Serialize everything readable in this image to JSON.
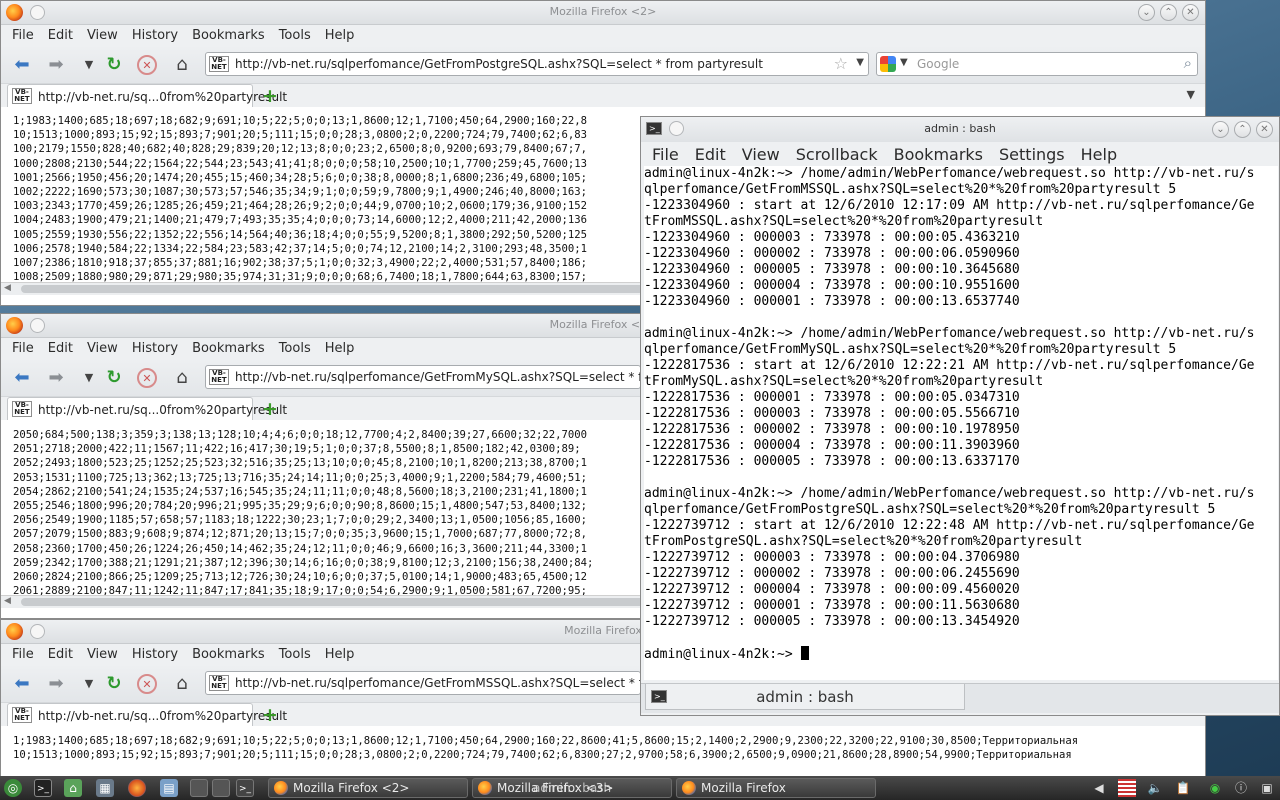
{
  "firefox_menu": [
    "File",
    "Edit",
    "View",
    "History",
    "Bookmarks",
    "Tools",
    "Help"
  ],
  "favicon_text": "VB-\nNET",
  "search_placeholder": "Google",
  "windows": [
    {
      "title": "Mozilla Firefox <2>",
      "url": "http://vb-net.ru/sqlperfomance/GetFromPostgreSQL.ashx?SQL=select * from partyresult",
      "tab_label": "http://vb-net.ru/sq...0from%20partyresult",
      "lines": [
        "1;1983;1400;685;18;697;18;682;9;691;10;5;22;5;0;0;13;1,8600;12;1,7100;450;64,2900;160;22,8",
        "10;1513;1000;893;15;92;15;893;7;901;20;5;111;15;0;0;28;3,0800;2;0,2200;724;79,7400;62;6,83",
        "100;2179;1550;828;40;682;40;828;29;839;20;12;13;8;0;0;23;2,6500;8;0,9200;693;79,8400;67;7,",
        "1000;2808;2130;544;22;1564;22;544;23;543;41;41;8;0;0;0;58;10,2500;10;1,7700;259;45,7600;13",
        "1001;2566;1950;456;20;1474;20;455;15;460;34;28;5;6;0;0;38;8,0000;8;1,6800;236;49,6800;105;",
        "1002;2222;1690;573;30;1087;30;573;57;546;35;34;9;1;0;0;59;9,7800;9;1,4900;246;40,8000;163;",
        "1003;2343;1770;459;26;1285;26;459;21;464;28;26;9;2;0;0;44;9,0700;10;2,0600;179;36,9100;152",
        "1004;2483;1900;479;21;1400;21;479;7;493;35;35;4;0;0;0;73;14,6000;12;2,4000;211;42,2000;136",
        "1005;2559;1930;556;22;1352;22;556;14;564;40;36;18;4;0;0;55;9,5200;8;1,3800;292;50,5200;125",
        "1006;2578;1940;584;22;1334;22;584;23;583;42;37;14;5;0;0;74;12,2100;14;2,3100;293;48,3500;1",
        "1007;2386;1810;918;37;855;37;881;16;902;38;37;5;1;0;0;32;3,4900;22;2,4000;531;57,8400;186;",
        "1008;2509;1880;980;29;871;29;980;35;974;31;31;9;0;0;0;68;6,7400;18;1,7800;644;63,8300;157;"
      ]
    },
    {
      "title": "Mozilla Firefox <3>",
      "url": "http://vb-net.ru/sqlperfomance/GetFromMySQL.ashx?SQL=select * from pa",
      "tab_label": "http://vb-net.ru/sq...0from%20partyresult",
      "lines": [
        "2050;684;500;138;3;359;3;138;13;128;10;4;4;6;0;0;18;12,7700;4;2,8400;39;27,6600;32;22,7000",
        "2051;2718;2000;422;11;1567;11;422;16;417;30;19;5;1;0;0;37;8,5500;8;1,8500;182;42,0300;89;",
        "2052;2493;1800;523;25;1252;25;523;32;516;35;25;13;10;0;0;45;8,2100;10;1,8200;213;38,8700;1",
        "2053;1531;1100;725;13;362;13;725;13;716;35;24;14;11;0;0;25;3,4000;9;1,2200;584;79,4600;51;",
        "2054;2862;2100;541;24;1535;24;537;16;545;35;24;11;11;0;0;48;8,5600;18;3,2100;231;41,1800;1",
        "2055;2546;1800;996;20;784;20;996;21;995;35;29;9;6;0;0;90;8,8600;15;1,4800;547;53,8400;132;",
        "2056;2549;1900;1185;57;658;57;1183;18;1222;30;23;1;7;0;0;29;2,3400;13;1,0500;1056;85,1600;",
        "2057;2079;1500;883;9;608;9;874;12;871;20;13;15;7;0;0;35;3,9600;15;1,7000;687;77,8000;72;8,",
        "2058;2360;1700;450;26;1224;26;450;14;462;35;24;12;11;0;0;46;9,6600;16;3,3600;211;44,3300;1",
        "2059;2342;1700;388;21;1291;21;387;12;396;30;14;6;16;0;0;38;9,8100;12;3,2100;156;38,2400;84;",
        "2060;2824;2100;866;25;1209;25;713;12;726;30;24;10;6;0;0;37;5,0100;14;1,9000;483;65,4500;12",
        "2061;2889;2100;847;11;1242;11;847;17;841;35;18;9;17;0;0;54;6,2900;9;1,0500;581;67,7200;95;"
      ]
    },
    {
      "title": "Mozilla Firefox",
      "url": "http://vb-net.ru/sqlperfomance/GetFromMSSQL.ashx?SQL=select * from pa",
      "tab_label": "http://vb-net.ru/sq...0from%20partyresult",
      "lines": [
        "1;1983;1400;685;18;697;18;682;9;691;10;5;22;5;0;0;13;1,8600;12;1,7100;450;64,2900;160;22,8600;41;5,8600;15;2,1400;2,2900;9,2300;22,3200;22,9100;30,8500;Территориальная",
        "10;1513;1000;893;15;92;15;893;7;901;20;5;111;15;0;0;28;3,0800;2;0,2200;724;79,7400;62;6,8300;27;2,9700;58;6,3900;2,6500;9,0900;21,8600;28,8900;54,9900;Территориальная"
      ]
    }
  ],
  "konsole": {
    "title": "admin : bash",
    "menu": [
      "File",
      "Edit",
      "View",
      "Scrollback",
      "Bookmarks",
      "Settings",
      "Help"
    ],
    "tab_label": "admin : bash",
    "lines": [
      "admin@linux-4n2k:~> /home/admin/WebPerfomance/webrequest.so http://vb-net.ru/s",
      "qlperfomance/GetFromMSSQL.ashx?SQL=select%20*%20from%20partyresult 5",
      "-1223304960 : start at 12/6/2010 12:17:09 AM http://vb-net.ru/sqlperfomance/Ge",
      "tFromMSSQL.ashx?SQL=select%20*%20from%20partyresult",
      "-1223304960 : 000003 : 733978 : 00:00:05.4363210",
      "-1223304960 : 000002 : 733978 : 00:00:06.0590960",
      "-1223304960 : 000005 : 733978 : 00:00:10.3645680",
      "-1223304960 : 000004 : 733978 : 00:00:10.9551600",
      "-1223304960 : 000001 : 733978 : 00:00:13.6537740",
      "",
      "admin@linux-4n2k:~> /home/admin/WebPerfomance/webrequest.so http://vb-net.ru/s",
      "qlperfomance/GetFromMySQL.ashx?SQL=select%20*%20from%20partyresult 5",
      "-1222817536 : start at 12/6/2010 12:22:21 AM http://vb-net.ru/sqlperfomance/Ge",
      "tFromMySQL.ashx?SQL=select%20*%20from%20partyresult",
      "-1222817536 : 000001 : 733978 : 00:00:05.0347310",
      "-1222817536 : 000003 : 733978 : 00:00:05.5566710",
      "-1222817536 : 000002 : 733978 : 00:00:10.1978950",
      "-1222817536 : 000004 : 733978 : 00:00:11.3903960",
      "-1222817536 : 000005 : 733978 : 00:00:13.6337170",
      "",
      "admin@linux-4n2k:~> /home/admin/WebPerfomance/webrequest.so http://vb-net.ru/s",
      "qlperfomance/GetFromPostgreSQL.ashx?SQL=select%20*%20from%20partyresult 5",
      "-1222739712 : start at 12/6/2010 12:22:48 AM http://vb-net.ru/sqlperfomance/Ge",
      "tFromPostgreSQL.ashx?SQL=select%20*%20from%20partyresult",
      "-1222739712 : 000003 : 733978 : 00:00:04.3706980",
      "-1222739712 : 000002 : 733978 : 00:00:06.2455690",
      "-1222739712 : 000004 : 733978 : 00:00:09.4560020",
      "-1222739712 : 000001 : 733978 : 00:00:11.5630680",
      "-1222739712 : 000005 : 733978 : 00:00:13.3454920",
      "",
      "admin@linux-4n2k:~> "
    ]
  },
  "taskbar": {
    "tasks": [
      "Mozilla Firefox <2>",
      "Mozilla Firefox <3>",
      "Mozilla Firefox"
    ],
    "overlap_label": "admin : bash"
  },
  "colors": {
    "chrome_bg": "#eef0f2",
    "taskbar_bg": "#2f2f2f",
    "reload": "#2e9a2e",
    "back": "#3b78c2"
  }
}
